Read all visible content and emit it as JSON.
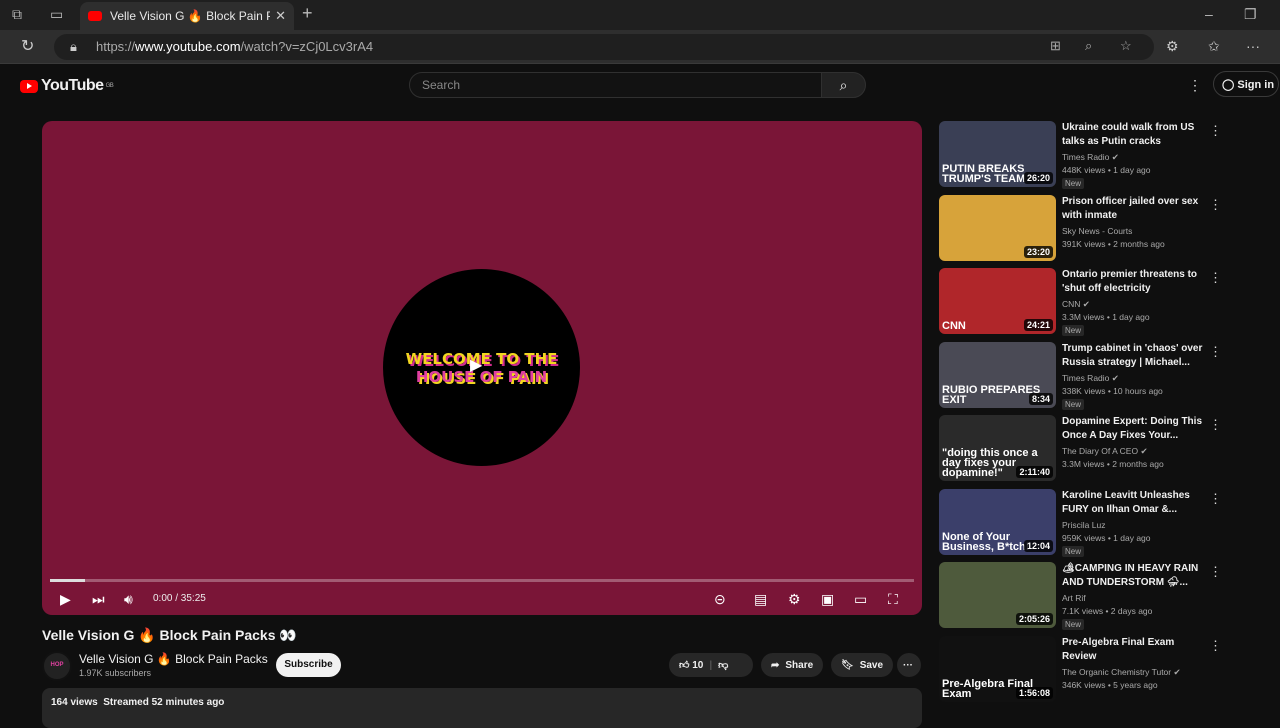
{
  "browser": {
    "tab_title": "Velle Vision G 🔥 Block Pain Packs",
    "url_prefix": "https://",
    "url_domain": "www.youtube.com",
    "url_path": "/watch?v=zCj0Lcv3rA4"
  },
  "header": {
    "logo": "YouTube",
    "region": "GB",
    "search_placeholder": "Search",
    "sign_in": "Sign in"
  },
  "player": {
    "art_line1": "WELCOME TO THE",
    "art_line2": "HOUSE OF PAIN",
    "time": "0:00 / 35:25",
    "progress": 0
  },
  "video": {
    "title": "Velle Vision G 🔥 Block Pain Packs 👀",
    "channel": "Velle Vision G 🔥 Block Pain Packs",
    "subscribers": "1.97K subscribers",
    "subscribe": "Subscribe",
    "likes": "10",
    "share": "Share",
    "save": "Save",
    "meta": "164 views  Streamed 52 minutes ago"
  },
  "recommendations": [
    {
      "title": "Ukraine could walk from US talks as Putin cracks Trump's...",
      "channel": "Times Radio",
      "verified": true,
      "meta": "448K views • 1 day ago",
      "badge": "New",
      "duration": "26:20",
      "thumb_text": "PUTIN BREAKS TRUMP'S TEAM",
      "color": "#3a3f55"
    },
    {
      "title": "Prison officer jailed over sex with inmate",
      "channel": "Sky News - Courts",
      "verified": false,
      "meta": "391K views • 2 months ago",
      "badge": "",
      "duration": "23:20",
      "thumb_text": "",
      "color": "#d7a33a"
    },
    {
      "title": "Ontario premier threatens to 'shut off electricity completely'...",
      "channel": "CNN",
      "verified": true,
      "meta": "3.3M views • 1 day ago",
      "badge": "New",
      "duration": "24:21",
      "thumb_text": "CNN",
      "color": "#b0262a"
    },
    {
      "title": "Trump cabinet in 'chaos' over Russia strategy | Michael...",
      "channel": "Times Radio",
      "verified": true,
      "meta": "338K views • 10 hours ago",
      "badge": "New",
      "duration": "8:34",
      "thumb_text": "RUBIO PREPARES EXIT",
      "color": "#4a4a55"
    },
    {
      "title": "Dopamine Expert: Doing This Once A Day Fixes Your...",
      "channel": "The Diary Of A CEO",
      "verified": true,
      "meta": "3.3M views • 2 months ago",
      "badge": "",
      "duration": "2:11:40",
      "thumb_text": "\"doing this once a day fixes your dopamine!\"",
      "color": "#2a2a2a"
    },
    {
      "title": "Karoline Leavitt Unleashes FURY on Ilhan Omar &...",
      "channel": "Priscila Luz",
      "verified": false,
      "meta": "959K views • 1 day ago",
      "badge": "New",
      "duration": "12:04",
      "thumb_text": "None of Your Business, B*tch!",
      "color": "#3b3f6a"
    },
    {
      "title": "🏕CAMPING IN HEAVY RAIN AND TUNDERSTORM ⛈...",
      "channel": "Art Rif",
      "verified": false,
      "meta": "7.1K views • 2 days ago",
      "badge": "New",
      "duration": "2:05:26",
      "thumb_text": "",
      "color": "#4e5a3c"
    },
    {
      "title": "Pre-Algebra Final Exam Review",
      "channel": "The Organic Chemistry Tutor",
      "verified": true,
      "meta": "346K views • 5 years ago",
      "badge": "",
      "duration": "1:56:08",
      "thumb_text": "Pre-Algebra Final Exam",
      "color": "#111111"
    }
  ]
}
